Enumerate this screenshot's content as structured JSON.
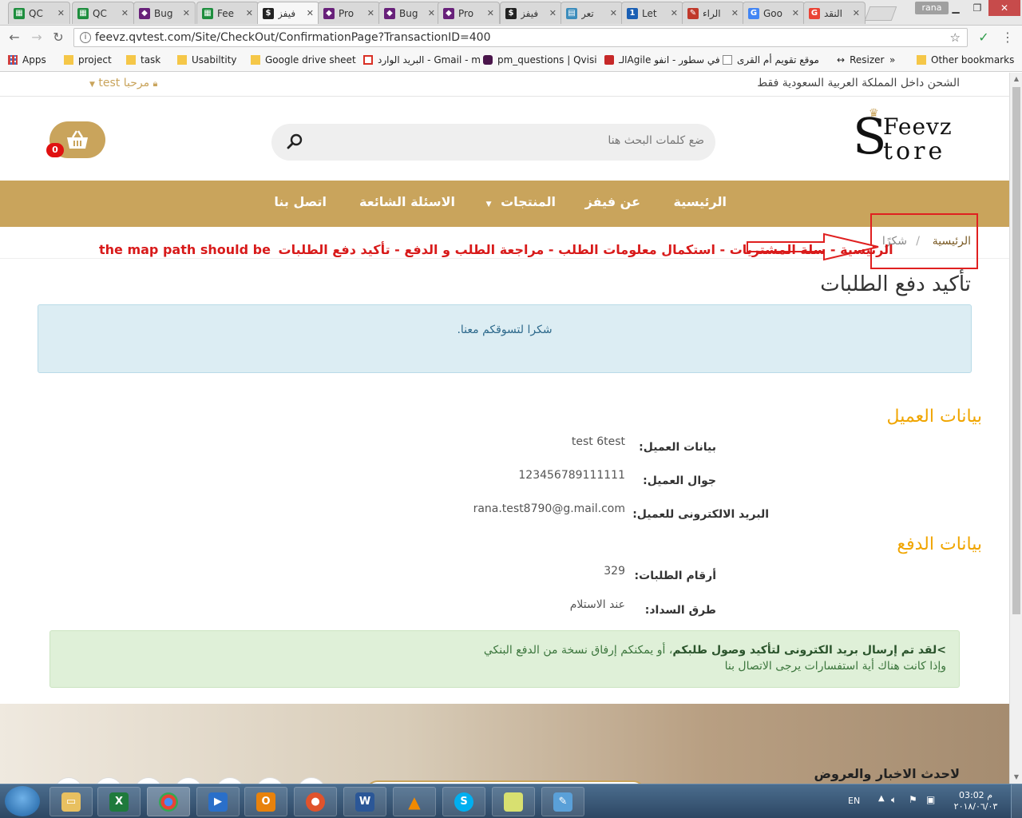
{
  "browser": {
    "tabs": [
      {
        "label": "QC",
        "color": "#1e8e3e",
        "glyph": "▦"
      },
      {
        "label": "QC",
        "color": "#1e8e3e",
        "glyph": "▦"
      },
      {
        "label": "Bug",
        "color": "#68217a",
        "glyph": "◆"
      },
      {
        "label": "Fee",
        "color": "#1e8e3e",
        "glyph": "▦"
      },
      {
        "label": "فيفز",
        "color": "#222222",
        "glyph": "$"
      },
      {
        "label": "Pro",
        "color": "#68217a",
        "glyph": "◆"
      },
      {
        "label": "Bug",
        "color": "#68217a",
        "glyph": "◆"
      },
      {
        "label": "Pro",
        "color": "#68217a",
        "glyph": "◆"
      },
      {
        "label": "فيفز",
        "color": "#222222",
        "glyph": "$"
      },
      {
        "label": "تعر",
        "color": "#3c8dbc",
        "glyph": "▤"
      },
      {
        "label": "Let",
        "color": "#1a5fb4",
        "glyph": "1"
      },
      {
        "label": "الراء",
        "color": "#c0392b",
        "glyph": "✎"
      },
      {
        "label": "Goo",
        "color": "#4285f4",
        "glyph": "G"
      },
      {
        "label": "النقد",
        "color": "#ea4335",
        "glyph": "G"
      }
    ],
    "user_chip": "rana",
    "url": "feevz.qvtest.com/Site/CheckOut/ConfirmationPage?TransactionID=400",
    "bookmarks": [
      {
        "label": "Apps",
        "icon": "apps-grid-icon"
      },
      {
        "label": "project",
        "icon": "folder-icon"
      },
      {
        "label": "task",
        "icon": "folder-icon"
      },
      {
        "label": "Usabiltity",
        "icon": "folder-icon"
      },
      {
        "label": "Google drive sheet",
        "icon": "folder-icon"
      },
      {
        "label": "البريد الوارد - Gmail - m",
        "icon": "gmail-icon"
      },
      {
        "label": "pm_questions | Qvisi",
        "icon": "slack-icon"
      },
      {
        "label": "الـAgile في سطور - انفو",
        "icon": "red-logo-icon"
      },
      {
        "label": "موقع تقويم أم القرى",
        "icon": "page-icon"
      },
      {
        "label": "Resizer",
        "icon": "arrows-icon"
      },
      {
        "label": "»",
        "icon": ""
      },
      {
        "label": "Other bookmarks",
        "icon": "folder-icon"
      }
    ]
  },
  "site": {
    "shipping_note": "الشحن داخل المملكة العربية السعودية فقط",
    "welcome": "مرحبا test",
    "logo_top": "Feevz",
    "logo_bottom": "tore",
    "logo_initial": "S",
    "search_placeholder": "ضع كلمات البحث هنا",
    "cart_count": "0",
    "nav": [
      "الرئيسية",
      "عن فيفز",
      "المنتجات",
      "الاسئلة الشائعة",
      "اتصل بنا"
    ],
    "breadcrumb": {
      "home": "الرئيسية",
      "separator": "/",
      "current": "شكرًا"
    },
    "annotation_en": "the map path should be",
    "annotation_ar": "الرئيسية - سلة المشتريات - استكمال معلومات الطلب - مراجعة الطلب و الدفع - تأكيد دفع الطلبات",
    "page_title": "تأكيد دفع الطلبات",
    "thanks_message": "شكرا لتسوقكم معنا.",
    "customer_section": "بيانات العميل",
    "customer_fields": [
      {
        "label": "بيانات العميل:",
        "value": "test 6test"
      },
      {
        "label": "جوال العميل:",
        "value": "123456789111111"
      },
      {
        "label": "البريد الالكترونى للعميل:",
        "value": "rana.test8790@g.mail.com"
      }
    ],
    "payment_section": "بيانات الدفع",
    "payment_fields": [
      {
        "label": "أرقام الطلبات:",
        "value": "329"
      },
      {
        "label": "طرق السداد:",
        "value": "عند الاستلام"
      }
    ],
    "notice_line1_bold": ">لقد تم إرسال بريد الكترونى لتأكيد وصول طلبكم",
    "notice_line1_rest": "، أو يمكنكم إرفاق نسخة من الدفع البنكي",
    "notice_line2": "وإذا كانت هناك أية استفسارات يرجى الاتصال بنا",
    "footer_news": "لاحدث الاخبار والعروض"
  },
  "taskbar": {
    "language": "EN",
    "time": "03:02 م",
    "date": "٢٠١٨/٠٦/٠٣"
  },
  "colors": {
    "gold": "#c9a45c",
    "orange_heading": "#f0a500",
    "annotation_red": "#d81a1a"
  }
}
